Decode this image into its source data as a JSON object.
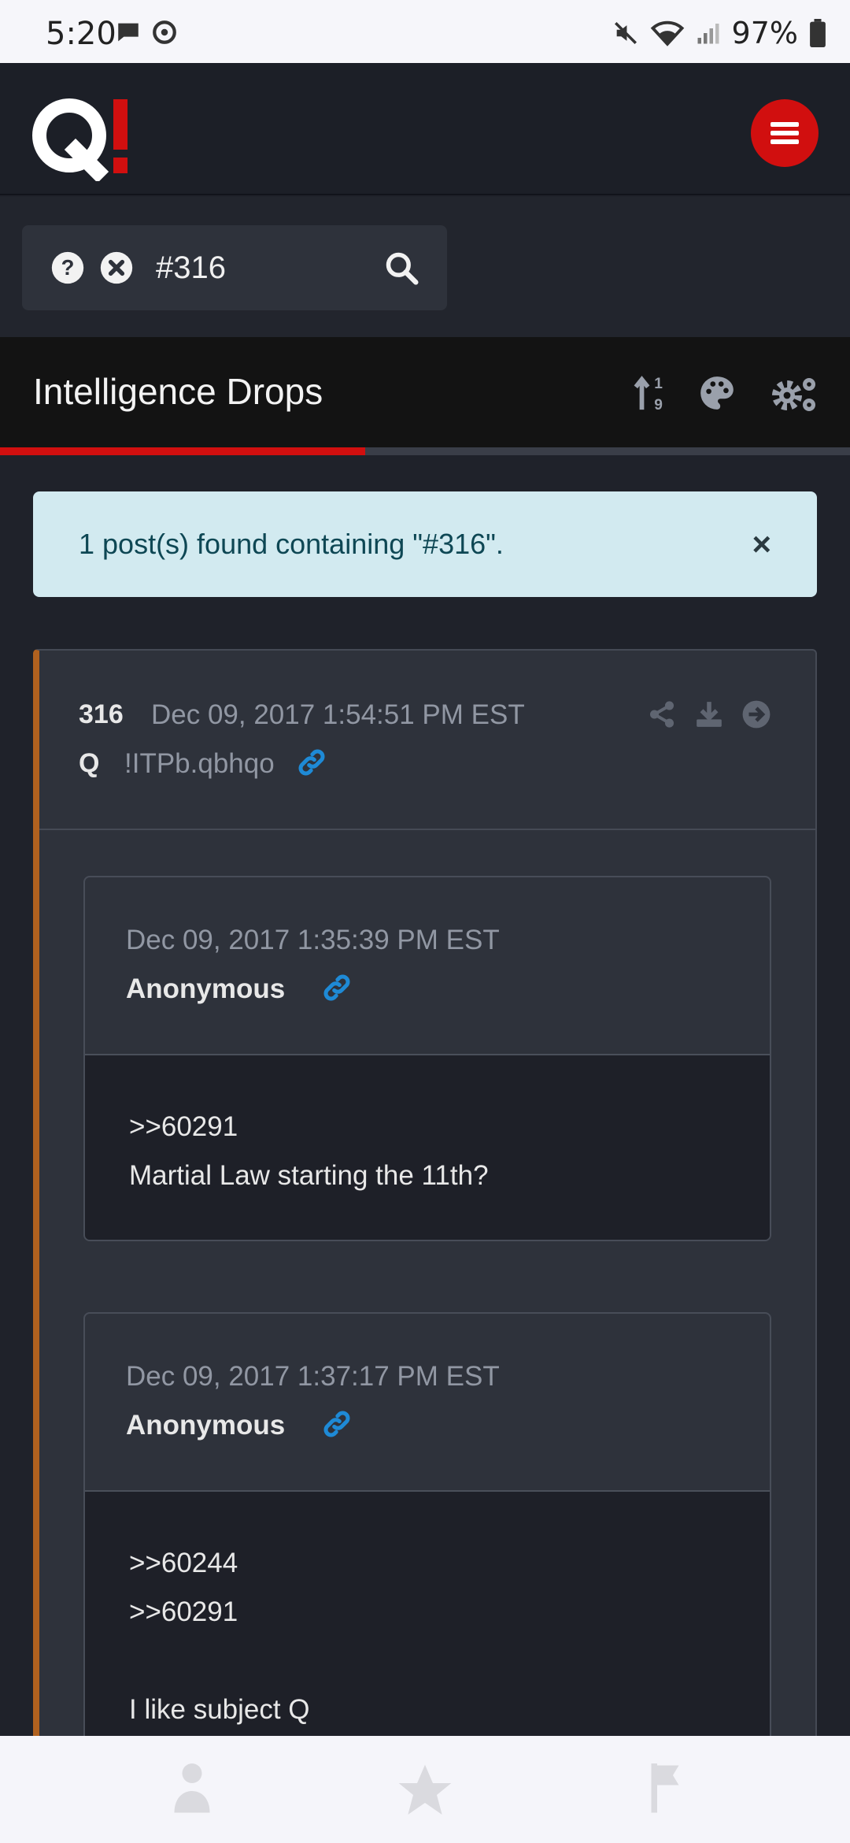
{
  "status": {
    "time": "5:20",
    "battery": "97%"
  },
  "header": {
    "logo_letter": "Q",
    "logo_mark": "!",
    "brand_color": "#d10f0f"
  },
  "search": {
    "value": "#316"
  },
  "section": {
    "title": "Intelligence Drops",
    "progress": 0.43
  },
  "alert": {
    "text": "1 post(s) found containing \"#316\".",
    "close": "×"
  },
  "post": {
    "number": "316",
    "date": "Dec 09, 2017 1:54:51 PM EST",
    "author": "Q",
    "trip": "!ITPb.qbhqo",
    "accent_color": "#b0611f",
    "replies": [
      {
        "date": "Dec 09, 2017 1:35:39 PM EST",
        "author": "Anonymous",
        "lines": [
          ">>60291",
          "Martial Law starting the 11th?"
        ]
      },
      {
        "date": "Dec 09, 2017 1:37:17 PM EST",
        "author": "Anonymous",
        "lines": [
          ">>60244",
          ">>60291",
          "",
          "I like subject Q"
        ]
      }
    ]
  },
  "icons": {
    "chat": "chat-bubble-icon",
    "sync": "sync-icon",
    "mute": "mute-icon",
    "wifi": "wifi-icon",
    "signal": "signal-icon",
    "battery": "battery-icon",
    "menu": "hamburger-icon",
    "help": "question-circle-icon",
    "clear": "close-circle-icon",
    "search": "search-icon",
    "sort": "sort-numeric-icon",
    "palette": "palette-icon",
    "settings": "gears-icon",
    "share": "share-icon",
    "download": "download-icon",
    "goto": "arrow-circle-right-icon",
    "link": "link-icon"
  }
}
